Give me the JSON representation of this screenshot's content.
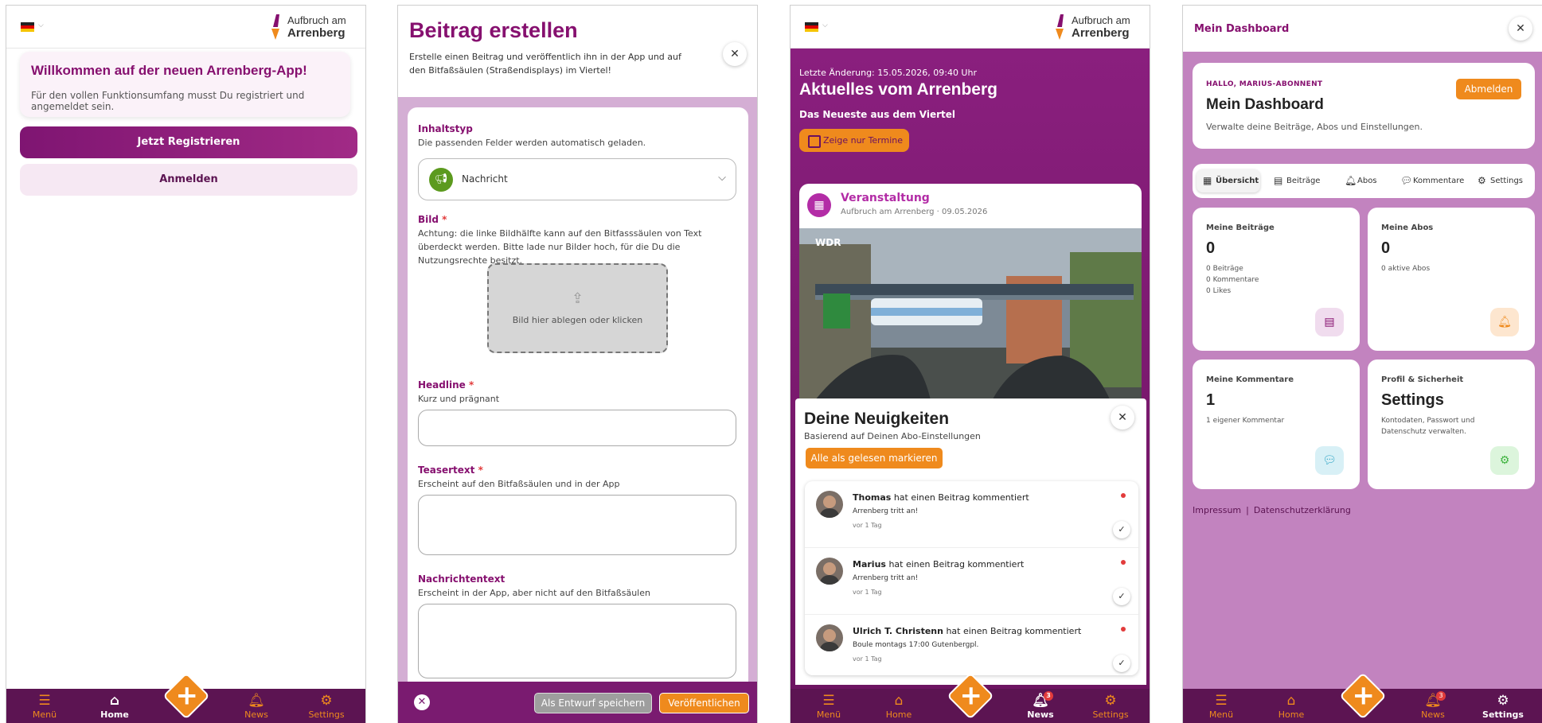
{
  "common": {
    "logo_line1": "Aufbruch am",
    "logo_line2": "Arrenberg",
    "nav": {
      "menu": "Menü",
      "home": "Home",
      "news": "News",
      "settings": "Settings"
    },
    "news_badge": "3",
    "colors": {
      "brand_purple": "#86106f",
      "nav_bg": "#5c1452",
      "accent_orange": "#ef8a1d"
    }
  },
  "welcome_screen": {
    "title": "Willkommen auf der neuen Arrenberg-App!",
    "text": "Für den vollen Funktionsumfang musst Du registriert und angemeldet sein.",
    "register_label": "Jetzt Registrieren",
    "login_label": "Anmelden"
  },
  "create_post": {
    "title": "Beitrag erstellen",
    "description": "Erstelle einen Beitrag und veröffentlich ihn in der App und auf den Bitfaßsäulen (Straßendisplays) im Viertel!",
    "content_type_label": "Inhaltstyp",
    "content_type_hint": "Die passenden Felder werden automatisch geladen.",
    "content_type_value": "Nachricht",
    "image_label": "Bild",
    "image_hint": "Achtung: die linke Bildhälfte kann auf den Bitfasssäulen von Text überdeckt werden. Bitte lade nur Bilder hoch, für die Du die Nutzungsrechte besitzt.",
    "dropzone_text": "Bild hier ablegen oder klicken",
    "headline_label": "Headline",
    "headline_hint": "Kurz und prägnant",
    "teaser_label": "Teasertext",
    "teaser_hint": "Erscheint auf den Bitfaßsäulen und in der App",
    "body_label": "Nachrichtentext",
    "body_hint": "Erscheint in der App, aber nicht auf den Bitfaßsäulen",
    "required_mark": "*",
    "draft_label": "Als Entwurf speichern",
    "publish_label": "Veröffentlichen"
  },
  "news_screen": {
    "last_change": "Letzte Änderung: 15.05.2026, 09:40 Uhr",
    "title": "Aktuelles vom Arrenberg",
    "subtitle": "Das Neueste aus dem Viertel",
    "filter_label": "Zeige nur Termine",
    "event": {
      "type": "Veranstaltung",
      "author": "Aufbruch am Arrenberg",
      "date": "09.05.2026",
      "image_label": "WDR"
    },
    "notifications_title": "Deine Neuigkeiten",
    "notifications_subtitle": "Basierend auf Deinen Abo-Einstellungen",
    "mark_all_label": "Alle als gelesen markieren",
    "notifications": [
      {
        "name": "Thomas",
        "action": "hat einen Beitrag kommentiert",
        "post": "Arrenberg tritt an!",
        "time": "vor 1 Tag"
      },
      {
        "name": "Marius",
        "action": "hat einen Beitrag kommentiert",
        "post": "Arrenberg tritt an!",
        "time": "vor 1 Tag"
      },
      {
        "name": "Ulrich T. Christenn",
        "action": "hat einen Beitrag kommentiert",
        "post": "Boule montags 17:00 Gutenbergpl.",
        "time": "vor 1 Tag"
      }
    ]
  },
  "dashboard": {
    "header_title": "Mein Dashboard",
    "greeting": "HALLO, MARIUS-ABONNENT",
    "title": "Mein Dashboard",
    "description": "Verwalte deine Beiträge, Abos und Einstellungen.",
    "logout_label": "Abmelden",
    "tabs": [
      "Übersicht",
      "Beiträge",
      "Abos",
      "Kommentare",
      "Settings"
    ],
    "cards": {
      "posts": {
        "title": "Meine Beiträge",
        "value": "0",
        "lines": [
          "0 Beiträge",
          "0 Kommentare",
          "0 Likes"
        ]
      },
      "subs": {
        "title": "Meine Abos",
        "value": "0",
        "lines": [
          "0 aktive Abos"
        ]
      },
      "comments": {
        "title": "Meine Kommentare",
        "value": "1",
        "lines": [
          "1 eigener Kommentar"
        ]
      },
      "profile": {
        "title": "Profil & Sicherheit",
        "value": "Settings",
        "lines": [
          "Kontodaten, Passwort und",
          "Datenschutz verwalten."
        ]
      }
    },
    "footer_links": [
      "Impressum",
      "Datenschutzerklärung"
    ],
    "footer_separator": "|"
  }
}
